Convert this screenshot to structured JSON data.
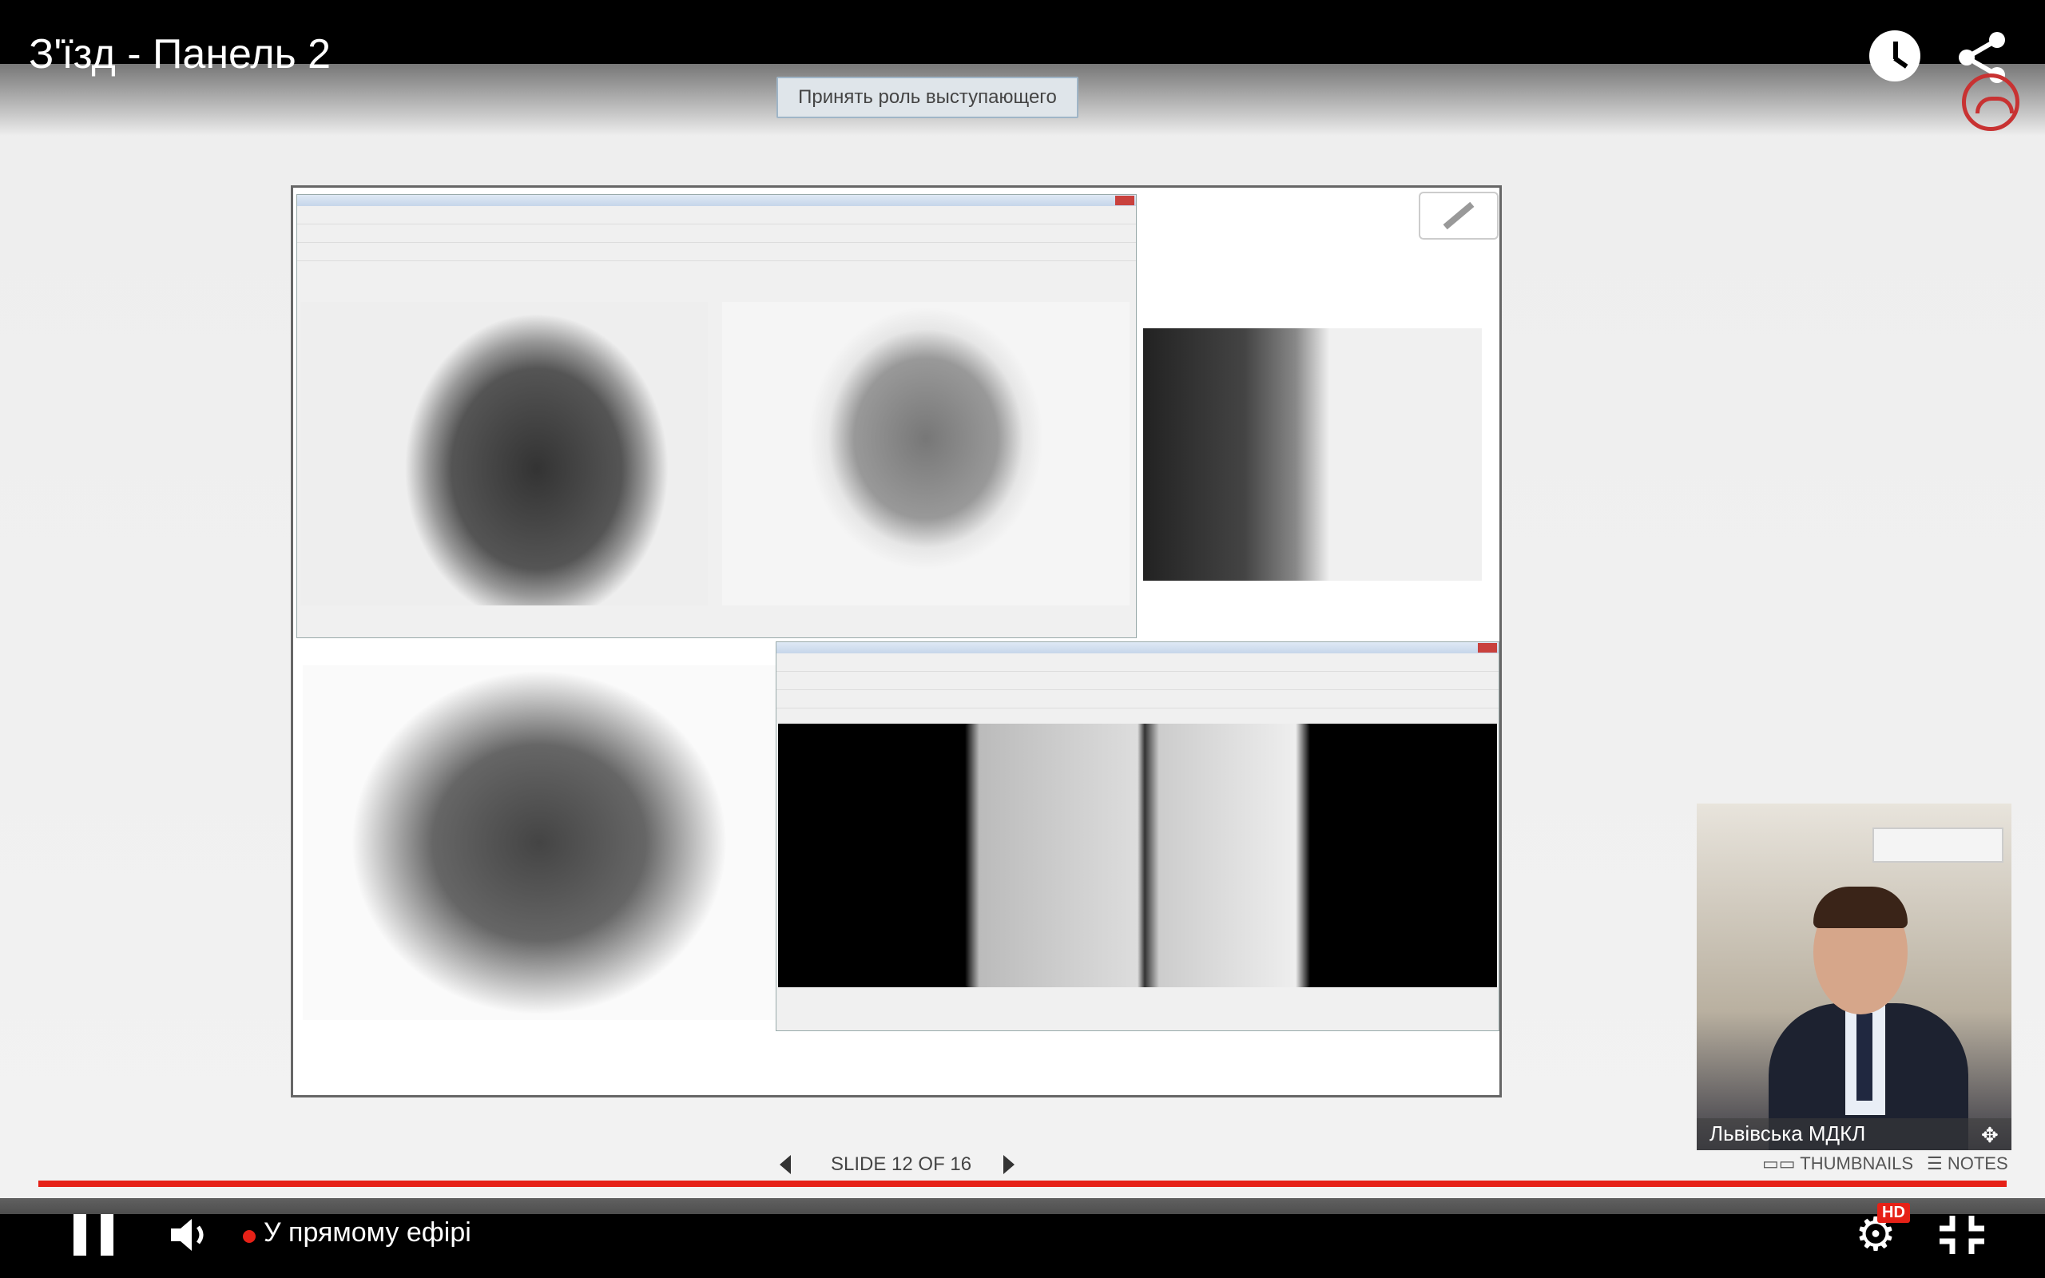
{
  "player": {
    "title": "З'їзд - Панель 2",
    "live_label": "У прямому ефірі",
    "hd_badge": "HD",
    "colors": {
      "accent": "#e62117",
      "hangup": "#c83232"
    }
  },
  "meeting": {
    "present_button": "Принять роль выступающего",
    "slide_counter": "SLIDE 12 OF 16",
    "thumbnails_label": "THUMBNAILS",
    "notes_label": "NOTES",
    "webcam_name": "Львівська МДКЛ"
  },
  "icons": {
    "clock": "clock-icon",
    "share": "share-icon",
    "hangup": "hangup-icon",
    "pencil": "pencil-icon",
    "prev": "triangle-left-icon",
    "next": "triangle-right-icon",
    "pause": "pause-icon",
    "volume": "volume-icon",
    "settings": "gear-icon",
    "exit_fullscreen": "exit-fullscreen-icon",
    "move": "move-icon"
  }
}
